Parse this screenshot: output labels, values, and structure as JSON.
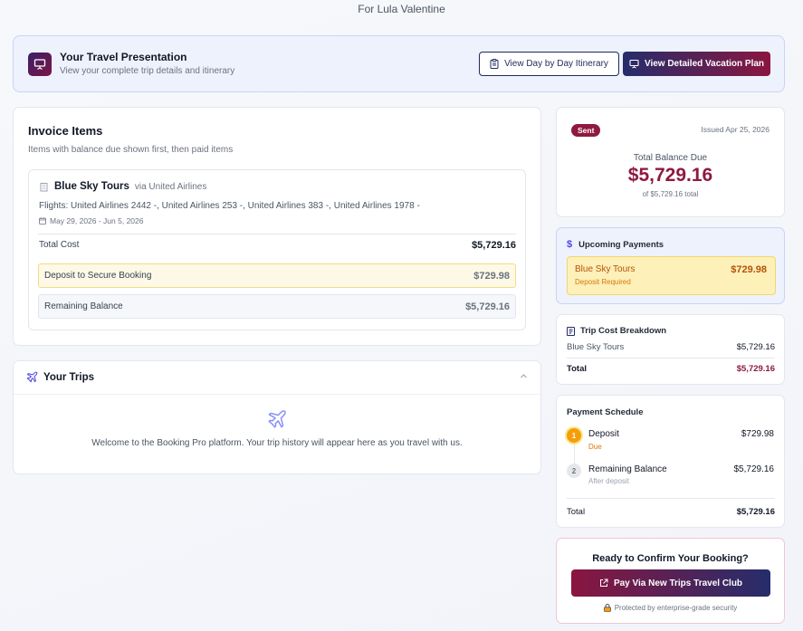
{
  "header": {
    "for_name": "For Lula Valentine"
  },
  "presentation": {
    "icon": "presentation-icon",
    "title": "Your Travel Presentation",
    "subtitle": "View your complete trip details and itinerary",
    "itinerary_button": "View Day by Day Itinerary",
    "plan_button": "View Detailed Vacation Plan"
  },
  "invoice": {
    "title": "Invoice Items",
    "subtitle": "Items with balance due shown first, then paid items",
    "item": {
      "vendor": "Blue Sky Tours",
      "via": "via United Airlines",
      "flights": "Flights: United Airlines 2442 -, United Airlines 253 -, United Airlines 383 -, United Airlines 1978 -",
      "dates": "May 29, 2026 - Jun 5, 2026",
      "total_label": "Total Cost",
      "total_value": "$5,729.16",
      "deposit_label": "Deposit to Secure Booking",
      "deposit_value": "$729.98",
      "remaining_label": "Remaining Balance",
      "remaining_value": "$5,729.16"
    }
  },
  "trips": {
    "title": "Your Trips",
    "message": "Welcome to the Booking Pro platform. Your trip history will appear here as you travel with us."
  },
  "status": {
    "badge": "Sent",
    "issued": "Issued Apr 25, 2026",
    "balance_label": "Total Balance Due",
    "balance_amount": "$5,729.16",
    "balance_of": "of $5,729.16 total"
  },
  "upcoming": {
    "title": "Upcoming Payments",
    "item_name": "Blue Sky Tours",
    "item_note": "Deposit Required",
    "item_amount": "$729.98"
  },
  "breakdown": {
    "title": "Trip Cost Breakdown",
    "rows": [
      {
        "label": "Blue Sky Tours",
        "value": "$5,729.16"
      }
    ],
    "total_label": "Total",
    "total_value": "$5,729.16"
  },
  "schedule": {
    "title": "Payment Schedule",
    "steps": [
      {
        "num": "1",
        "name": "Deposit",
        "note": "Due",
        "amount": "$729.98"
      },
      {
        "num": "2",
        "name": "Remaining Balance",
        "note": "After deposit",
        "amount": "$5,729.16"
      }
    ],
    "total_label": "Total",
    "total_value": "$5,729.16"
  },
  "confirm": {
    "title": "Ready to Confirm Your Booking?",
    "button": "Pay Via New Trips Travel Club",
    "secure": "Protected by enterprise-grade security"
  },
  "colors": {
    "brand_maroon": "#8f1a3f",
    "brand_navy": "#252d6b",
    "deposit_amber": "#b45309"
  }
}
